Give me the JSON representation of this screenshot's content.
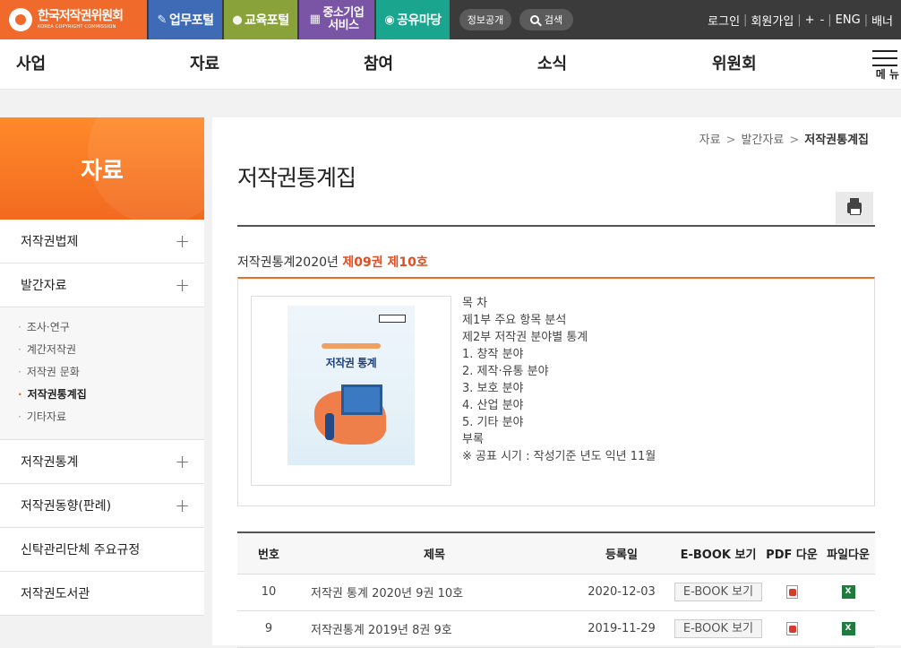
{
  "topbar": {
    "logo_ko": "한국저작권위원회",
    "logo_en": "KOREA COPYRIGHT COMMISSION",
    "portals": [
      "업무포털",
      "교육포털",
      "중소기업\n서비스",
      "공유마당"
    ],
    "info_label": "정보공개",
    "search_label": "검색",
    "login": "로그인",
    "signup": "회원가입",
    "zoom_in": "+",
    "zoom_out": "-",
    "lang": "ENG",
    "banner": "배너"
  },
  "gnb": {
    "items": [
      "사업",
      "자료",
      "참여",
      "소식",
      "위원회"
    ],
    "menu_label": "메 뉴"
  },
  "sidebar": {
    "title": "자료",
    "items": [
      "저작권법제",
      "발간자료",
      "저작권통계",
      "저작권동향(판례)",
      "신탁관리단체 주요규정",
      "저작권도서관"
    ],
    "sub_items": [
      "조사·연구",
      "계간저작권",
      "저작권 문화",
      "저작권통계집",
      "기타자료"
    ]
  },
  "breadcrumb": [
    "자료",
    "발간자료",
    "저작권통계집"
  ],
  "page_title": "저작권통계집",
  "detail": {
    "subtitle_prefix": "저작권통계2020년 ",
    "subtitle_highlight": "제09권 제10호",
    "cover_title": "저작권 통계",
    "toc": [
      "목 차",
      "제1부 주요 항목 분석",
      "제2부 저작권 분야별 통계",
      "1. 창작 분야",
      "2. 제작·유통 분야",
      "3. 보호 분야",
      "4. 산업 분야",
      "5. 기타 분야",
      "부록",
      "※ 공표 시기 : 작성기준 년도 익년 11월"
    ]
  },
  "table": {
    "headers": [
      "번호",
      "제목",
      "등록일",
      "E-BOOK 보기",
      "PDF 다운",
      "파일다운"
    ],
    "rows": [
      {
        "no": "10",
        "title": "저작권 통계 2020년 9권 10호",
        "date": "2020-12-03",
        "ebook": "E-BOOK 보기"
      },
      {
        "no": "9",
        "title": "저작권통계 2019년 8권 9호",
        "date": "2019-11-29",
        "ebook": "E-BOOK 보기"
      }
    ]
  },
  "colors": {
    "brand": "#f06a2c",
    "highlight": "#e84b1c"
  }
}
